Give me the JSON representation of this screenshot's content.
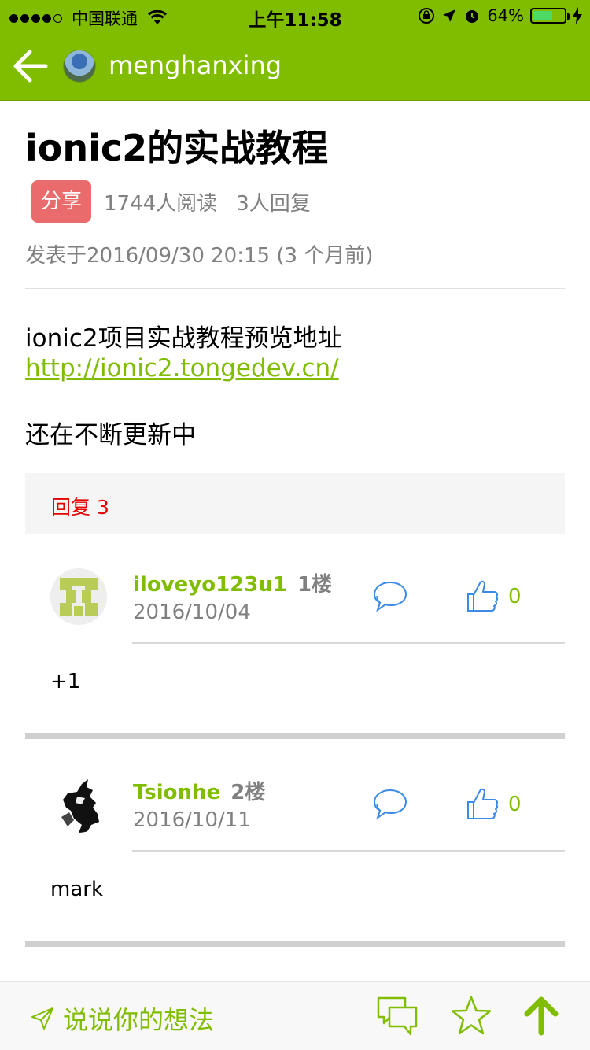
{
  "status_bar": {
    "carrier": "中国联通",
    "time": "上午11:58",
    "battery": "64%",
    "battery_level": 0.64
  },
  "nav": {
    "title": "menghanxing"
  },
  "article": {
    "title": "ionic2的实战教程",
    "tag": "分享",
    "reads": "1744人阅读",
    "replies": "3人回复",
    "posted": "发表于2016/09/30 20:15 (3 个月前)",
    "content_line1": "ionic2项目实战教程预览地址",
    "link": "http://ionic2.tongedev.cn/",
    "content_line2": "还在不断更新中"
  },
  "reply_section": {
    "header": "回复 3"
  },
  "replies": [
    {
      "author": "iloveyo123u1",
      "floor": "1楼",
      "date": "2016/10/04",
      "likes": "0",
      "body": "+1"
    },
    {
      "author": "Tsionhe",
      "floor": "2楼",
      "date": "2016/10/11",
      "likes": "0",
      "body": "mark"
    }
  ],
  "bottom_bar": {
    "input_placeholder": "说说你的想法"
  },
  "colors": {
    "brand_green": "#80bd01",
    "tag_red": "#e96b6b",
    "reply_red": "#e60000",
    "icon_blue": "#3b8be6"
  },
  "icons": {
    "back": "back-arrow-icon",
    "wifi": "wifi-icon",
    "reply": "speech-bubble-icon",
    "like": "thumbs-up-icon",
    "send": "send-icon",
    "comments": "comments-icon",
    "favorite": "star-icon",
    "top": "arrow-up-icon"
  }
}
